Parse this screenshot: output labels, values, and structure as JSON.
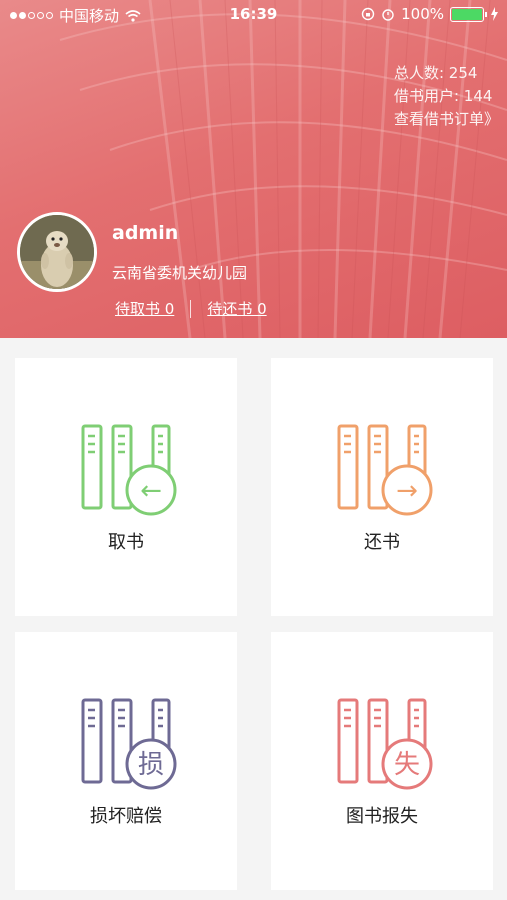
{
  "status_bar": {
    "carrier": "中国移动",
    "time": "16:39",
    "battery": "100%"
  },
  "stats": {
    "total": "总人数: 254",
    "borrowers": "借书用户: 144",
    "view_orders": "查看借书订单》"
  },
  "profile": {
    "username": "admin",
    "organization": "云南省委机关幼儿园",
    "pending_pickup": "待取书 0",
    "pending_return": "待还书 0"
  },
  "tiles": [
    {
      "label": "取书",
      "glyph": "←",
      "color": "#7fce74",
      "icon": "book-pickup-icon"
    },
    {
      "label": "还书",
      "glyph": "→",
      "color": "#f0a06a",
      "icon": "book-return-icon"
    },
    {
      "label": "损坏赔偿",
      "glyph": "损",
      "color": "#6e6a94",
      "icon": "damage-compensation-icon"
    },
    {
      "label": "图书报失",
      "glyph": "失",
      "color": "#e57a7a",
      "icon": "book-lost-icon"
    }
  ]
}
